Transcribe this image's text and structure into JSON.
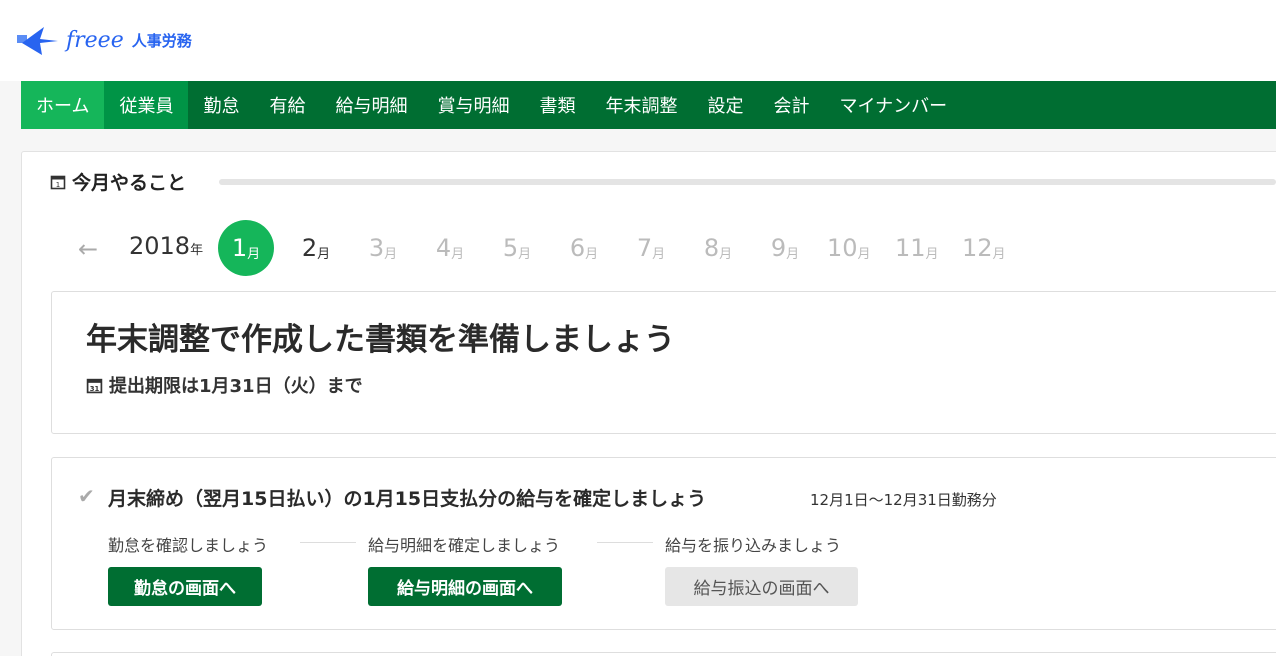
{
  "header": {
    "logo_text": "freee",
    "logo_sub": "人事労務"
  },
  "nav": {
    "items": [
      {
        "label": "ホーム"
      },
      {
        "label": "従業員"
      },
      {
        "label": "勤怠"
      },
      {
        "label": "有給"
      },
      {
        "label": "給与明細"
      },
      {
        "label": "賞与明細"
      },
      {
        "label": "書類"
      },
      {
        "label": "年末調整"
      },
      {
        "label": "設定"
      },
      {
        "label": "会計"
      },
      {
        "label": "マイナンバー"
      }
    ]
  },
  "section": {
    "title": "今月やること"
  },
  "calendar": {
    "year": "2018",
    "year_suffix": "年",
    "month_suffix": "月",
    "months": [
      "1",
      "2",
      "3",
      "4",
      "5",
      "6",
      "7",
      "8",
      "9",
      "10",
      "11",
      "12"
    ],
    "active_month": "1"
  },
  "task_main": {
    "title": "年末調整で作成した書類を準備しましょう",
    "deadline": "提出期限は1月31日（火）まで",
    "deadline_icon_text": "31"
  },
  "task_payroll": {
    "title": "月末締め（翌月15日払い）の1月15日支払分の給与を確定しましょう",
    "period": "12月1日〜12月31日勤務分",
    "steps": [
      {
        "label": "勤怠を確認しましょう",
        "button": "勤怠の画面へ"
      },
      {
        "label": "給与明細を確定しましょう",
        "button": "給与明細の画面へ"
      },
      {
        "label": "給与を振り込みましょう",
        "button": "給与振込の画面へ"
      }
    ]
  },
  "colors": {
    "nav_bg": "#006e32",
    "nav_active": "#15b65a",
    "accent_green": "#15b65a",
    "button_green": "#006e32",
    "logo_blue": "#2864f0"
  }
}
